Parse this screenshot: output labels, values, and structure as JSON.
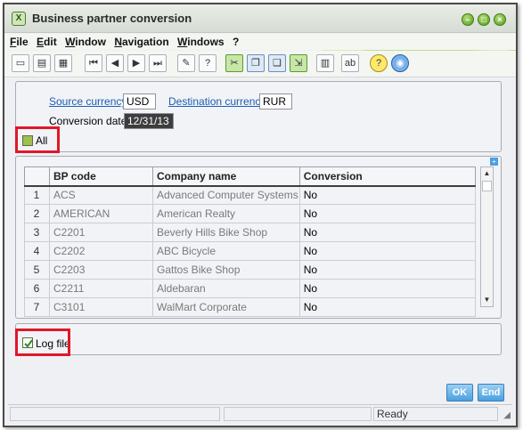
{
  "window": {
    "title": "Business partner conversion",
    "minimize_icon": "minimize-icon",
    "restore_icon": "restore-icon",
    "close_icon": "close-icon"
  },
  "menu": [
    "File",
    "Edit",
    "Window",
    "Navigation",
    "Windows",
    "?"
  ],
  "toolbar_icons": [
    "new-doc-icon",
    "print-icon",
    "preview-icon",
    "first-icon",
    "prev-icon",
    "next-icon",
    "last-icon",
    "attach-icon",
    "help-icon",
    "tools-icon",
    "copy-icon",
    "paste-icon",
    "export-icon",
    "report-icon",
    "text-icon",
    "info-icon",
    "globe-icon"
  ],
  "params": {
    "source_currency_label": "Source currency",
    "source_currency_value": "USD",
    "destination_currency_label": "Destination currency",
    "destination_currency_value": "RUR",
    "conversion_date_label": "Conversion date",
    "conversion_date_value": "12/31/13",
    "all_label": "All",
    "all_checked": false
  },
  "grid": {
    "columns": [
      "BP code",
      "Company name",
      "Conversion"
    ],
    "rows": [
      {
        "num": "1",
        "code": "ACS",
        "company": "Advanced Computer Systems",
        "conversion": "No"
      },
      {
        "num": "2",
        "code": "AMERICAN",
        "company": "American Realty",
        "conversion": "No"
      },
      {
        "num": "3",
        "code": "C2201",
        "company": "Beverly Hills Bike Shop",
        "conversion": "No"
      },
      {
        "num": "4",
        "code": "C2202",
        "company": "ABC Bicycle",
        "conversion": "No"
      },
      {
        "num": "5",
        "code": "C2203",
        "company": "Gattos Bike Shop",
        "conversion": "No"
      },
      {
        "num": "6",
        "code": "C2211",
        "company": "Aldebaran",
        "conversion": "No"
      },
      {
        "num": "7",
        "code": "C3101",
        "company": "WalMart Corporate",
        "conversion": "No"
      }
    ]
  },
  "log": {
    "label": "Log file",
    "checked": true
  },
  "buttons": {
    "ok": "OK",
    "end": "End"
  },
  "status": {
    "text": "Ready"
  },
  "colors": {
    "highlight": "#e0172a",
    "link": "#1a5fb4",
    "button": "#4a9fe0"
  }
}
